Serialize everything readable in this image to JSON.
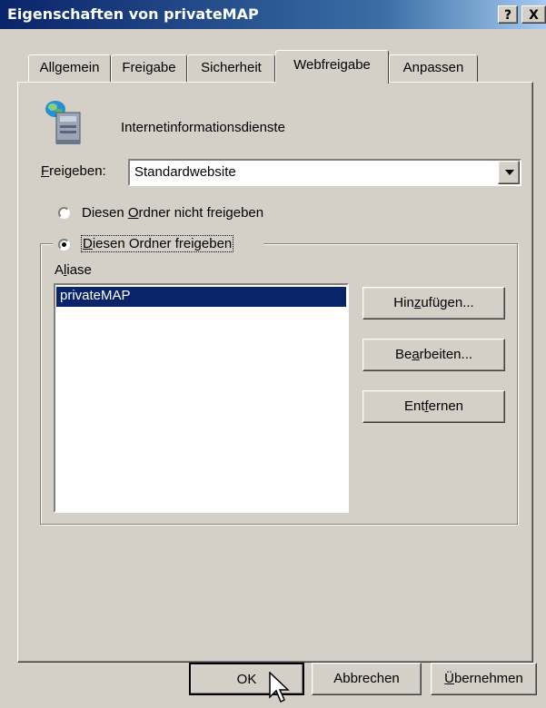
{
  "window": {
    "title": "Eigenschaften von privateMAP",
    "help_btn": "?",
    "close_btn": "X"
  },
  "tabs": [
    {
      "label": "Allgemein"
    },
    {
      "label": "Freigabe"
    },
    {
      "label": "Sicherheit"
    },
    {
      "label": "Webfreigabe",
      "active": true
    },
    {
      "label": "Anpassen"
    }
  ],
  "service": {
    "label": "Internetinformationsdienste",
    "icon": "server-icon"
  },
  "share": {
    "label": "Freigeben:",
    "value": "Standardwebsite"
  },
  "options": {
    "no_share": "Diesen Ordner nicht freigeben",
    "share": "Diesen Ordner freigeben",
    "selected": "share"
  },
  "aliases": {
    "label": "Aliase",
    "items": [
      "privateMAP"
    ],
    "selected_index": 0,
    "selection_color": "#0a246a"
  },
  "buttons": {
    "add": "Hinzufügen...",
    "edit": "Bearbeiten...",
    "remove": "Entfernen",
    "ok": "OK",
    "cancel": "Abbrechen",
    "apply": "Übernehmen"
  }
}
